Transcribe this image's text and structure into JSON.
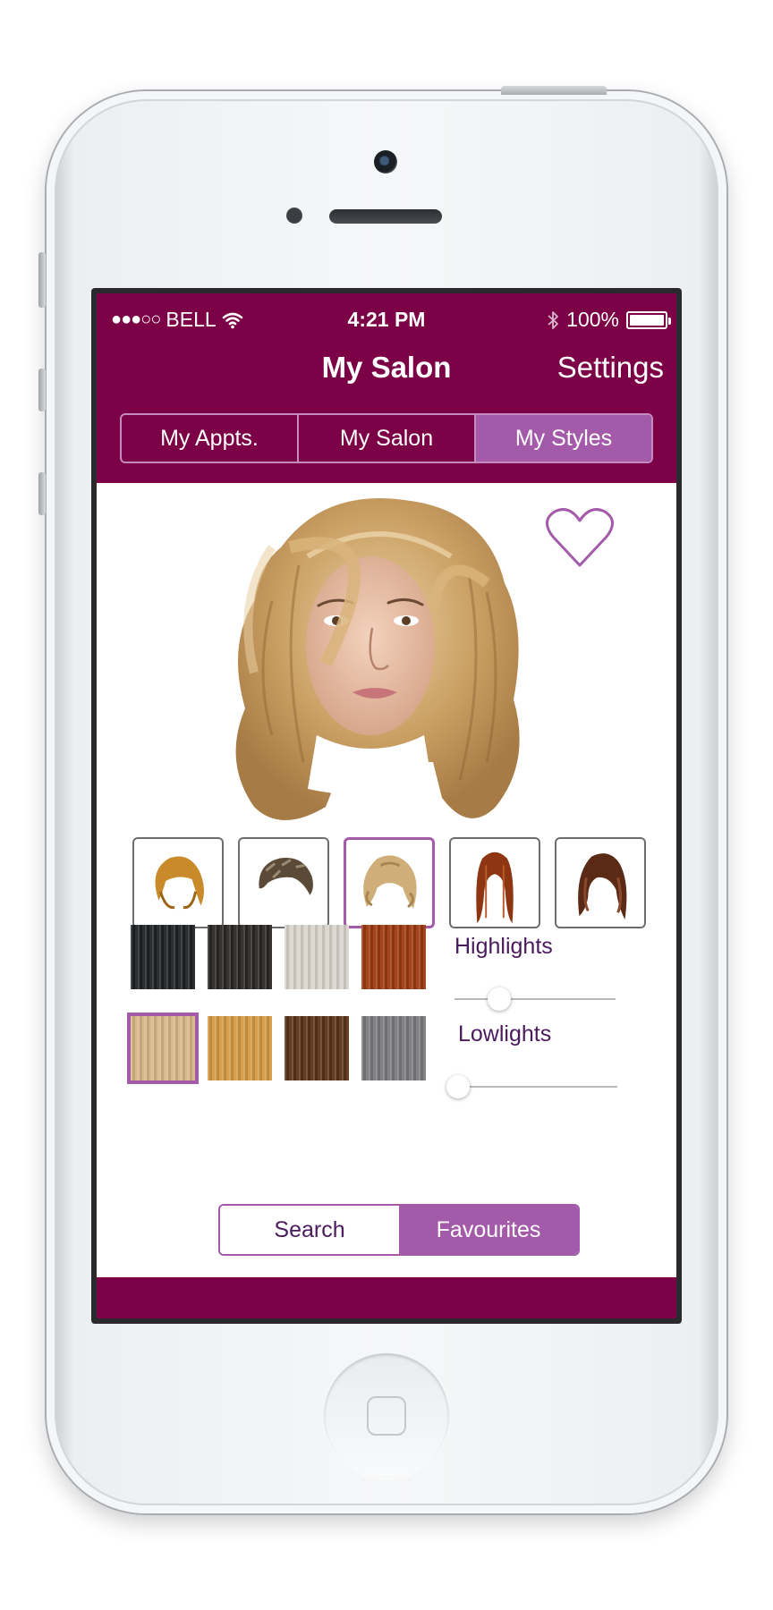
{
  "status_bar": {
    "signal_dots": "●●●○○",
    "carrier": "BELL",
    "time": "4:21 PM",
    "battery_percent": "100%",
    "icons": [
      "wifi-icon",
      "bluetooth-icon",
      "battery-icon"
    ]
  },
  "nav": {
    "title": "My Salon",
    "settings_label": "Settings"
  },
  "tabs": [
    {
      "label": "My Appts.",
      "active": false
    },
    {
      "label": "My Salon",
      "active": false
    },
    {
      "label": "My Styles",
      "active": true
    }
  ],
  "preview": {
    "favorite_icon": "heart-outline-icon"
  },
  "hairstyles": [
    {
      "name": "golden-bob",
      "selected": false
    },
    {
      "name": "short-textured-brown",
      "selected": false
    },
    {
      "name": "curly-blonde",
      "selected": true
    },
    {
      "name": "long-straight-auburn",
      "selected": false
    },
    {
      "name": "long-layered-brown",
      "selected": false
    }
  ],
  "color_swatches": [
    {
      "name": "jet-black",
      "color": "#1e2123",
      "selected": false
    },
    {
      "name": "soft-black",
      "color": "#2a2725",
      "selected": false
    },
    {
      "name": "platinum",
      "color": "#d9d4cc",
      "selected": false
    },
    {
      "name": "copper-red",
      "color": "#9b3a10",
      "selected": false
    },
    {
      "name": "honey-blonde",
      "color": "#d8b888",
      "selected": true
    },
    {
      "name": "golden-blonde",
      "color": "#d39a45",
      "selected": false
    },
    {
      "name": "chestnut-brown",
      "color": "#5a3418",
      "selected": false
    },
    {
      "name": "ash-grey",
      "color": "#7a7b7c",
      "selected": false
    }
  ],
  "highlights": {
    "label": "Highlights",
    "value": 0.28
  },
  "lowlights": {
    "label": "Lowlights",
    "value": 0.02
  },
  "bottom_tabs": [
    {
      "label": "Search",
      "active": false
    },
    {
      "label": "Favourites",
      "active": true
    }
  ],
  "colors": {
    "brand": "#7b0045",
    "accent": "#a35aa9",
    "text_accent": "#4a1a5c"
  }
}
